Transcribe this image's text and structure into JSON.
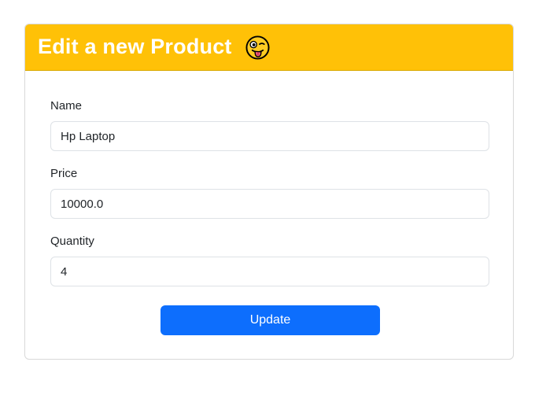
{
  "header": {
    "title": "Edit a new Product",
    "emoji_icon": "winking-face-with-tongue-icon",
    "bg_color": "#ffc107"
  },
  "form": {
    "name": {
      "label": "Name",
      "value": "Hp Laptop"
    },
    "price": {
      "label": "Price",
      "value": "10000.0"
    },
    "quantity": {
      "label": "Quantity",
      "value": "4"
    },
    "submit_label": "Update",
    "submit_color": "#0d6efd"
  }
}
